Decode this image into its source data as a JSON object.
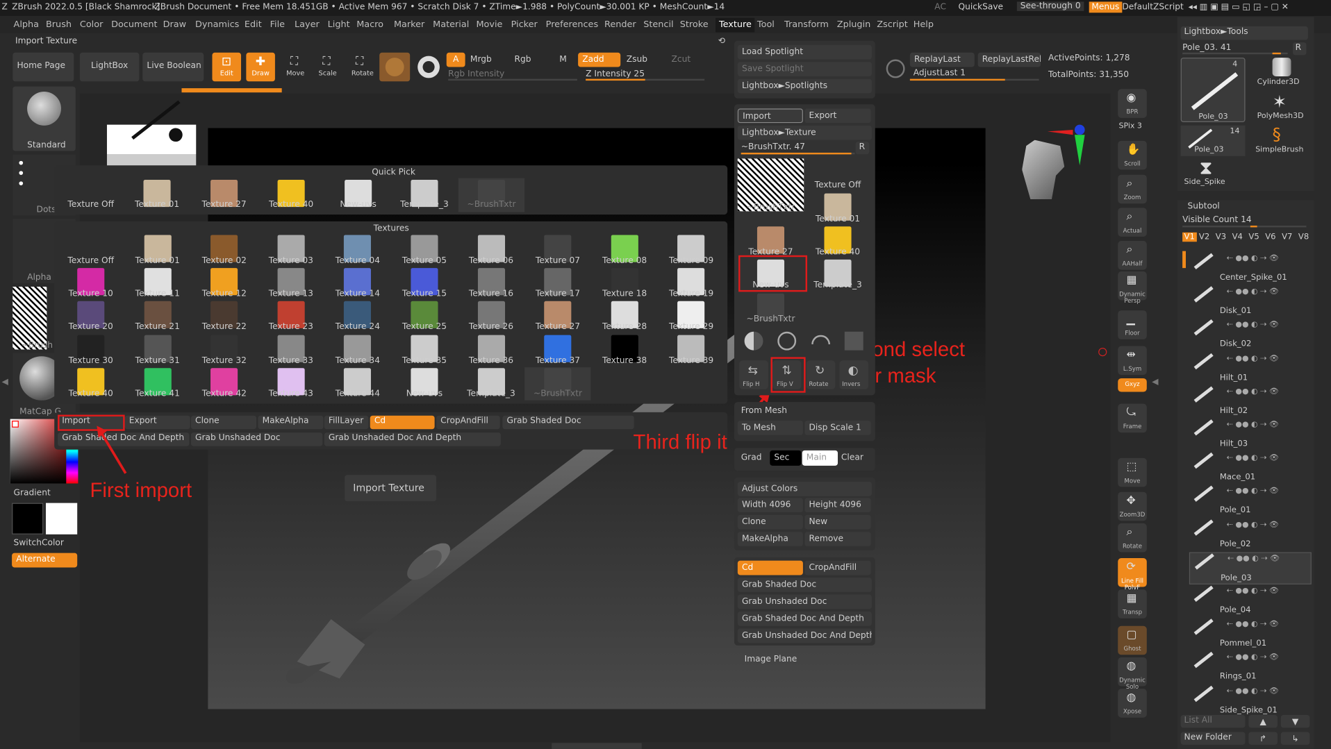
{
  "titlebar": {
    "app": "ZBrush 2022.0.5 [Black Shamrock]",
    "doc": "ZBrush Document",
    "stats": "• Free Mem 18.451GB • Active Mem 967 • Scratch Disk 7 • ZTime►1.988 • PolyCount►30.001 KP • MeshCount►14",
    "ac": "AC",
    "quicksave": "QuickSave",
    "seethrough": "See-through  0",
    "menus": "Menus",
    "script": "DefaultZScript"
  },
  "menu": [
    "Alpha",
    "Brush",
    "Color",
    "Document",
    "Draw",
    "Dynamics",
    "Edit",
    "File",
    "Layer",
    "Light",
    "Macro",
    "Marker",
    "Material",
    "Movie",
    "Picker",
    "Preferences",
    "Render",
    "Stencil",
    "Stroke",
    "Texture",
    "Tool",
    "Transform",
    "Zplugin",
    "Zscript",
    "Help"
  ],
  "header": {
    "import_texture": "Import Texture",
    "home": "Home Page",
    "lightbox": "LightBox",
    "liveboolean": "Live Boolean",
    "edit": "Edit",
    "draw": "Draw",
    "move": "Move",
    "scale": "Scale",
    "rotate": "Rotate",
    "a": "A",
    "mrgb": "Mrgb",
    "rgb": "Rgb",
    "m": "M",
    "zadd": "Zadd",
    "zsub": "Zsub",
    "zcut": "Zcut",
    "rgbint": "Rgb Intensity",
    "zint": "Z Intensity 25",
    "replaylast": "ReplayLast",
    "replaylastrel": "ReplayLastRel",
    "activepoints": "ActivePoints: 1,278",
    "adjustlast": "AdjustLast 1",
    "totalpoints": "TotalPoints: 31,350"
  },
  "left": {
    "standard": "Standard",
    "dots": "Dots",
    "alpha": "Alpha O",
    "brush": "~Brush",
    "matcap": "MatCap G",
    "gradient": "Gradient",
    "switchcolor": "SwitchColor",
    "alternate": "Alternate"
  },
  "quickpick": {
    "title": "Quick Pick",
    "items": [
      "Texture Off",
      "Texture 01",
      "Texture 27",
      "Texture 40",
      "New-uvs",
      "Template_3",
      "~BrushTxtr"
    ]
  },
  "textures": {
    "title": "Textures",
    "items": [
      "Texture Off",
      "Texture 01",
      "Texture 02",
      "Texture 03",
      "Texture 04",
      "Texture 05",
      "Texture 06",
      "Texture 07",
      "Texture 08",
      "Texture 09",
      "Texture 10",
      "Texture 11",
      "Texture 12",
      "Texture 13",
      "Texture 14",
      "Texture 15",
      "Texture 16",
      "Texture 17",
      "Texture 18",
      "Texture 19",
      "Texture 20",
      "Texture 21",
      "Texture 22",
      "Texture 23",
      "Texture 24",
      "Texture 25",
      "Texture 26",
      "Texture 27",
      "Texture 28",
      "Texture 29",
      "Texture 30",
      "Texture 31",
      "Texture 32",
      "Texture 33",
      "Texture 34",
      "Texture 35",
      "Texture 36",
      "Texture 37",
      "Texture 38",
      "Texture 39",
      "Texture 40",
      "Texture 41",
      "Texture 42",
      "Texture 43",
      "Texture 44",
      "New-uvs",
      "Template_3",
      "~BrushTxtr"
    ],
    "thumb_colors": [
      "#3a3a3a",
      "#c9b79c",
      "#8a5a2c",
      "#aaaaaa",
      "#6f8fb0",
      "#999",
      "#bbb",
      "#444",
      "#7ad04f",
      "#ccc",
      "#d42aa5",
      "#e0e0e0",
      "#f0a020",
      "#888",
      "#5a6fd0",
      "#4a5ad8",
      "#777",
      "#666",
      "#333",
      "#ddd",
      "#5a4a7a",
      "#6a5040",
      "#4a3a30",
      "#c04030",
      "#3a5a7a",
      "#5a8a3a",
      "#777",
      "#b98a6a",
      "#ddd",
      "#eee",
      "#222",
      "#555",
      "#333",
      "#888",
      "#999",
      "#ccc",
      "#aaa",
      "#3070e0",
      "#000",
      "#bbb",
      "#f0c020",
      "#30c060",
      "#e040a0",
      "#e0c0f0",
      "#ccc",
      "#ddd",
      "#ccc",
      "#444"
    ]
  },
  "actions": {
    "import": "Import",
    "export": "Export",
    "clone": "Clone",
    "makealpha": "MakeAlpha",
    "filllayer": "FillLayer",
    "cd": "Cd",
    "cropandfill": "CropAndFill",
    "grabshaded": "Grab Shaded Doc",
    "grabshadeddepth": "Grab Shaded Doc And Depth",
    "grabunshaded": "Grab Unshaded Doc",
    "grabunshadeddepth": "Grab Unshaded Doc And Depth"
  },
  "tooltip": "Import Texture",
  "annotations": {
    "first": "First import",
    "second1": "Second select",
    "second2": "your mask",
    "third": "Third flip it"
  },
  "texpanel": {
    "loadspot": "Load Spotlight",
    "savespot": "Save Spotlight",
    "lbspot": "Lightbox►Spotlights",
    "import": "Import",
    "export": "Export",
    "lbtex": "Lightbox►Texture",
    "brushtxtr": "~BrushTxtr. 47",
    "r": "R",
    "items": [
      "~BrushTxtr",
      "Texture Off",
      "Texture 01",
      "Texture 27",
      "Texture 40",
      "New-uvs",
      "Template_3",
      "~BrushTxtr"
    ],
    "fliph": "Flip H",
    "flipv": "Flip V",
    "rotate": "Rotate",
    "invers": "Invers",
    "frommesh": "From Mesh",
    "tomesh": "To Mesh",
    "dispscale": "Disp Scale 1",
    "grad": "Grad",
    "sec": "Sec",
    "main": "Main",
    "clear": "Clear",
    "adjust": "Adjust Colors",
    "width": "Width 4096",
    "height": "Height 4096",
    "clone": "Clone",
    "new": "New",
    "makealpha": "MakeAlpha",
    "remove": "Remove",
    "cd": "Cd",
    "cropandfill": "CropAndFill",
    "gsd": "Grab Shaded Doc",
    "gud": "Grab Unshaded Doc",
    "gsdd": "Grab Shaded Doc And Depth",
    "gudd": "Grab Unshaded Doc And Depth",
    "imageplane": "Image Plane"
  },
  "shelf": [
    "BPR",
    "SPix 3",
    "Scroll",
    "Zoom",
    "Actual",
    "AAHalf",
    "Dynamic Persp",
    "Floor",
    "L.Sym",
    "Gxyz",
    "Frame",
    "Move",
    "Zoom3D",
    "Rotate",
    "Line Fill PolyF",
    "Transp",
    "Ghost",
    "Dynamic Solo",
    "Xpose"
  ],
  "tool": {
    "lbtools": "Lightbox►Tools",
    "pole": "Pole_03. 41",
    "r": "R",
    "pole03": "Pole_03",
    "cyl": "Cylinder3D",
    "poly": "PolyMesh3D",
    "simple": "SimpleBrush",
    "side": "Side_Spike",
    "n4": "4",
    "n14": "14"
  },
  "subtool": {
    "title": "Subtool",
    "visible": "Visible Count 14",
    "v": [
      "V1",
      "V2",
      "V3",
      "V4",
      "V5",
      "V6",
      "V7",
      "V8"
    ],
    "items": [
      "Center_Spike_01",
      "Disk_01",
      "Disk_02",
      "Hilt_01",
      "Hilt_02",
      "Hilt_03",
      "Mace_01",
      "Pole_01",
      "Pole_02",
      "Pole_03",
      "Pole_04",
      "Pommel_01",
      "Rings_01",
      "Side_Spike_01"
    ],
    "listall": "List All",
    "newfolder": "New Folder"
  }
}
